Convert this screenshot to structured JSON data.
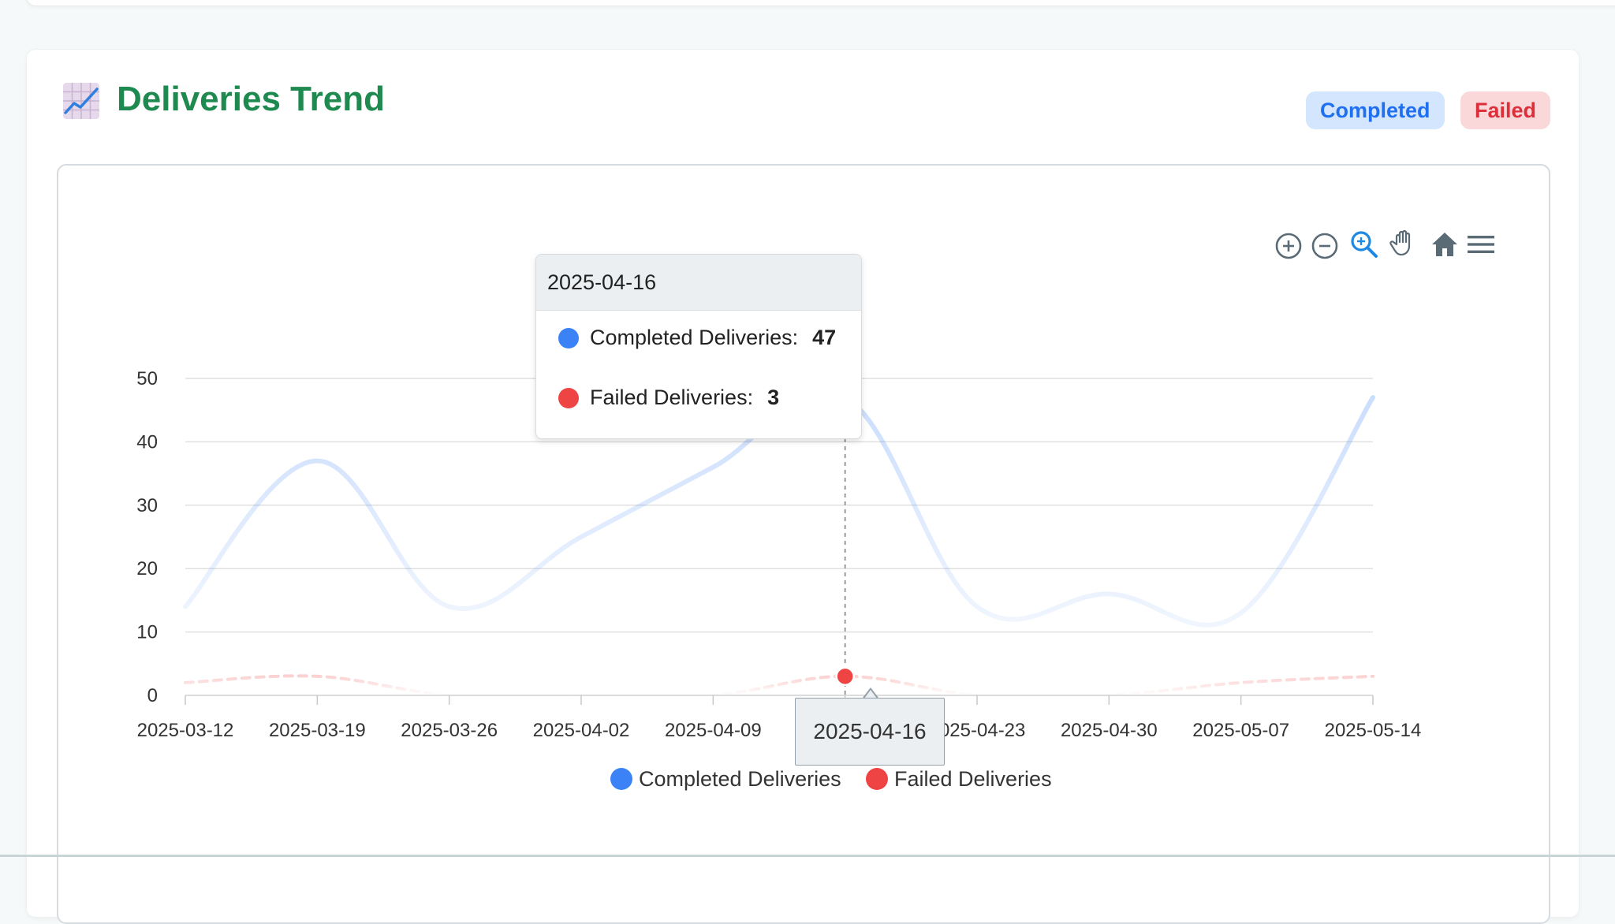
{
  "header": {
    "title": "Deliveries Trend",
    "badges": [
      {
        "label": "Completed",
        "color": "#1f6ff0",
        "bg": "#d4e6fd"
      },
      {
        "label": "Failed",
        "color": "#dc2f3a",
        "bg": "#fad8da"
      }
    ],
    "icon": "chart-increasing-icon"
  },
  "toolbar": {
    "icons": [
      "zoom-in-icon",
      "zoom-out-icon",
      "selection-zoom-icon",
      "pan-hand-icon",
      "reset-home-icon",
      "menu-icon"
    ]
  },
  "tooltip": {
    "date": "2025-04-16",
    "rows": [
      {
        "label": "Completed Deliveries:",
        "value": "47",
        "color": "#3b82f6"
      },
      {
        "label": "Failed Deliveries:",
        "value": "3",
        "color": "#ef4444"
      }
    ]
  },
  "crosshair_label": "2025-04-16",
  "chart_data": {
    "type": "line",
    "x": [
      "2025-03-12",
      "2025-03-19",
      "2025-03-26",
      "2025-04-02",
      "2025-04-09",
      "2025-04-16",
      "2025-04-23",
      "2025-04-30",
      "2025-05-07",
      "2025-05-14"
    ],
    "x_ticks": [
      "2025-03-12",
      "2025-03-19",
      "2025-03-26",
      "2025-04-02",
      "2025-04-09",
      "2025-04-16",
      "2025-04-23",
      "2025-04-30",
      "2025-05-07",
      "2025-05-14"
    ],
    "y_ticks": [
      0,
      10,
      20,
      30,
      40,
      50
    ],
    "ylim": [
      0,
      50
    ],
    "series": [
      {
        "name": "Completed Deliveries",
        "color": "#3b82f6",
        "values": [
          14,
          37,
          14,
          25,
          36,
          47,
          14,
          16,
          13,
          47
        ]
      },
      {
        "name": "Failed Deliveries",
        "color": "#ef4444",
        "values": [
          2,
          3,
          0,
          0,
          0,
          3,
          0,
          0,
          2,
          3
        ]
      }
    ],
    "highlight_index": 5,
    "legend_position": "bottom",
    "grid": true
  }
}
